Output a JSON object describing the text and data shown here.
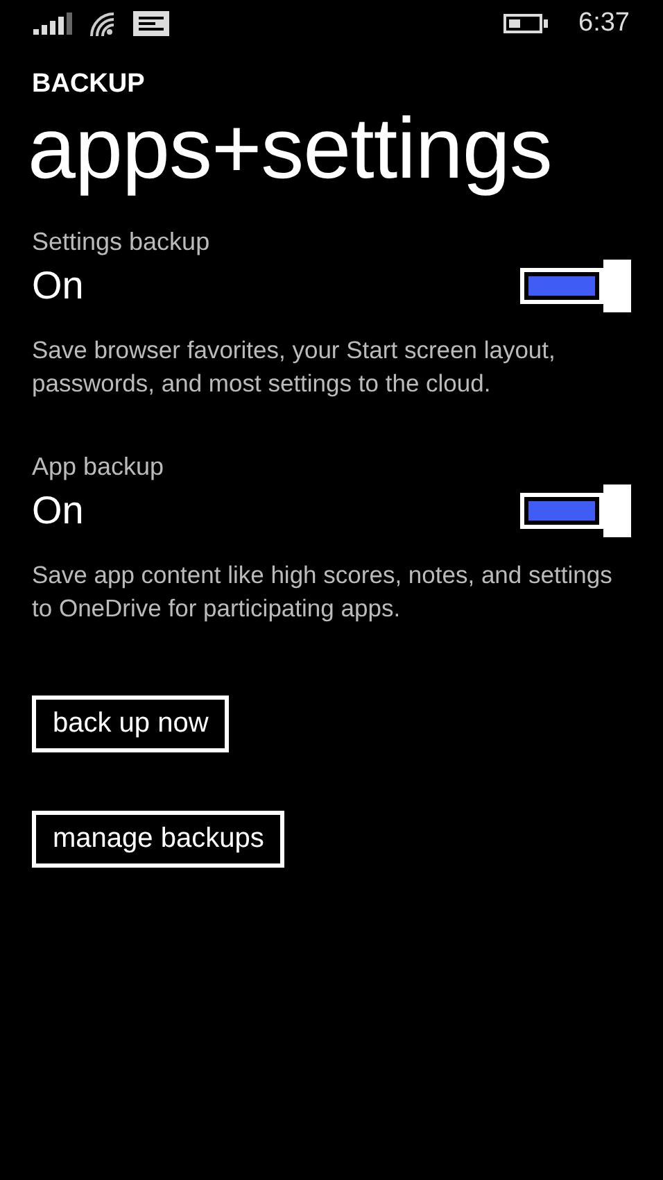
{
  "status_bar": {
    "time": "6:37"
  },
  "header": "BACKUP",
  "title": "apps+settings",
  "settings": [
    {
      "label": "Settings backup",
      "state": "On",
      "on": true,
      "description": "Save browser favorites, your Start screen layout, passwords, and most settings to the cloud."
    },
    {
      "label": "App backup",
      "state": "On",
      "on": true,
      "description": "Save app content like high scores, notes, and settings to OneDrive for participating apps."
    }
  ],
  "buttons": [
    "back up now",
    "manage backups"
  ]
}
